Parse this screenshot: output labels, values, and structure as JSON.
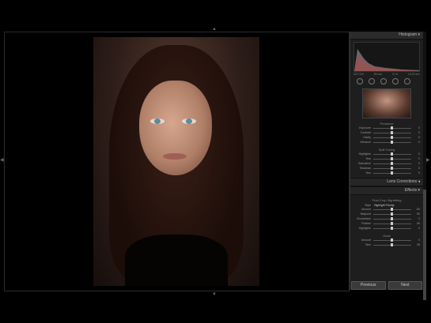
{
  "panel": {
    "histogram_label": "Histogram",
    "histogram_info": [
      "ISO 200",
      "85 mm",
      "f/1.8",
      "1/125 sec"
    ],
    "presence_title": "Presence",
    "presence_rows": [
      {
        "label": "Exposure",
        "value": "0"
      },
      {
        "label": "Contrast",
        "value": "0"
      },
      {
        "label": "Clarity",
        "value": "0"
      },
      {
        "label": "Vibrance",
        "value": "0"
      }
    ],
    "split_title": "Split Toning",
    "split_rows": [
      {
        "label": "Highlights",
        "value": "0"
      },
      {
        "label": "Hue",
        "value": "0"
      },
      {
        "label": "Saturation",
        "value": "0"
      },
      {
        "label": "Shadows",
        "value": "0"
      },
      {
        "label": "Hue",
        "value": "0"
      }
    ],
    "lens_label": "Lens Corrections",
    "effects_label": "Effects",
    "vignette_title": "Post-Crop Vignetting",
    "style_label": "Style",
    "style_value": "Highlight Priority",
    "vignette_rows": [
      {
        "label": "Amount",
        "value": "-50"
      },
      {
        "label": "Midpoint",
        "value": "50"
      },
      {
        "label": "Roundness",
        "value": "0"
      },
      {
        "label": "Feather",
        "value": "50"
      },
      {
        "label": "Highlights",
        "value": "0"
      }
    ],
    "grain_title": "Grain",
    "grain_rows": [
      {
        "label": "Amount",
        "value": "0"
      },
      {
        "label": "Size",
        "value": "25"
      }
    ]
  },
  "buttons": {
    "previous": "Previous",
    "next": "Next"
  },
  "arrows": {
    "up": "▲",
    "down": "▼",
    "left": "◀",
    "right": "▶"
  },
  "colors": {
    "background": "#000000",
    "panel": "#1e1e1e",
    "accent": "#cccccc"
  }
}
